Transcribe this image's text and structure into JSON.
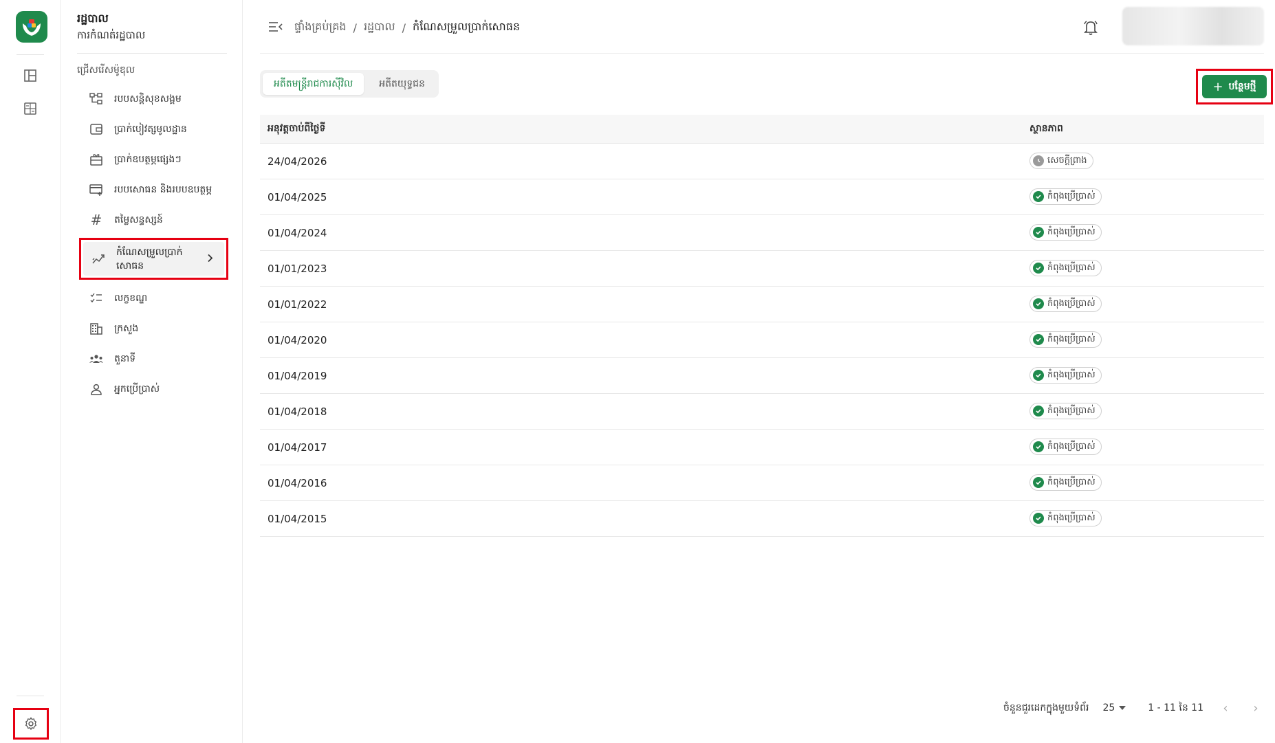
{
  "app": {
    "brand_color": "#1f8a4c",
    "highlight_color": "#e60012"
  },
  "rail": {
    "icons": [
      "dashboard-icon",
      "calculator-icon"
    ],
    "settings_icon": "gear-icon"
  },
  "sidebar": {
    "org_title": "រដ្ឋបាល",
    "org_subtitle": "ការកំណត់រដ្ឋបាល",
    "section_heading": "ជ្រើសរើសម៉ូឌុល",
    "items": [
      {
        "label": "របបសន្តិសុខសង្គម",
        "icon": "hierarchy-icon"
      },
      {
        "label": "ប្រាក់បៀវត្សមូលដ្ឋាន",
        "icon": "wallet-icon"
      },
      {
        "label": "ប្រាក់ឧបត្ថម្ភផ្សេងៗ",
        "icon": "gift-icon"
      },
      {
        "label": "របបសោធន និងរបបឧបត្ថម្ភ",
        "icon": "card-add-icon"
      },
      {
        "label": "តម្លៃសន្ទស្សន៍",
        "icon": "hash-icon"
      },
      {
        "label": "កំណែសម្រួលប្រាក់សោធន",
        "icon": "trend-icon",
        "active": true
      },
      {
        "label": "លក្ខខណ្ឌ",
        "icon": "checklist-icon"
      },
      {
        "label": "ក្រសួង",
        "icon": "building-icon"
      },
      {
        "label": "តួនាទី",
        "icon": "group-icon"
      },
      {
        "label": "អ្នកប្រើប្រាស់",
        "icon": "user-icon"
      }
    ]
  },
  "header": {
    "breadcrumbs": [
      "ផ្ទាំងគ្រប់គ្រង",
      "រដ្ឋបាល",
      "កំណែសម្រួលប្រាក់សោធន"
    ],
    "separator": "/"
  },
  "tabs": [
    {
      "label": "អតីតមន្ត្រីរាជការស៊ីវិល",
      "active": true
    },
    {
      "label": "អតីតយុទ្ធជន",
      "active": false
    }
  ],
  "toolbar": {
    "add_label": "បន្ថែមថ្មី"
  },
  "table": {
    "columns": [
      "អនុវត្តចាប់ពីថ្ងៃទី",
      "ស្ថានភាព"
    ],
    "rows": [
      {
        "date": "24/04/2026",
        "status": "សេចក្តីព្រាង",
        "kind": "future"
      },
      {
        "date": "01/04/2025",
        "status": "កំពុងប្រើប្រាស់",
        "kind": "active"
      },
      {
        "date": "01/04/2024",
        "status": "កំពុងប្រើប្រាស់",
        "kind": "active"
      },
      {
        "date": "01/01/2023",
        "status": "កំពុងប្រើប្រាស់",
        "kind": "active"
      },
      {
        "date": "01/01/2022",
        "status": "កំពុងប្រើប្រាស់",
        "kind": "active"
      },
      {
        "date": "01/04/2020",
        "status": "កំពុងប្រើប្រាស់",
        "kind": "active"
      },
      {
        "date": "01/04/2019",
        "status": "កំពុងប្រើប្រាស់",
        "kind": "active"
      },
      {
        "date": "01/04/2018",
        "status": "កំពុងប្រើប្រាស់",
        "kind": "active"
      },
      {
        "date": "01/04/2017",
        "status": "កំពុងប្រើប្រាស់",
        "kind": "active"
      },
      {
        "date": "01/04/2016",
        "status": "កំពុងប្រើប្រាស់",
        "kind": "active"
      },
      {
        "date": "01/04/2015",
        "status": "កំពុងប្រើប្រាស់",
        "kind": "active"
      }
    ]
  },
  "pagination": {
    "rows_per_page_label": "ចំនួនជួរដេកក្នុងមួយទំព័រ",
    "rows_per_page": "25",
    "range": "1 - 11 នៃ 11"
  }
}
